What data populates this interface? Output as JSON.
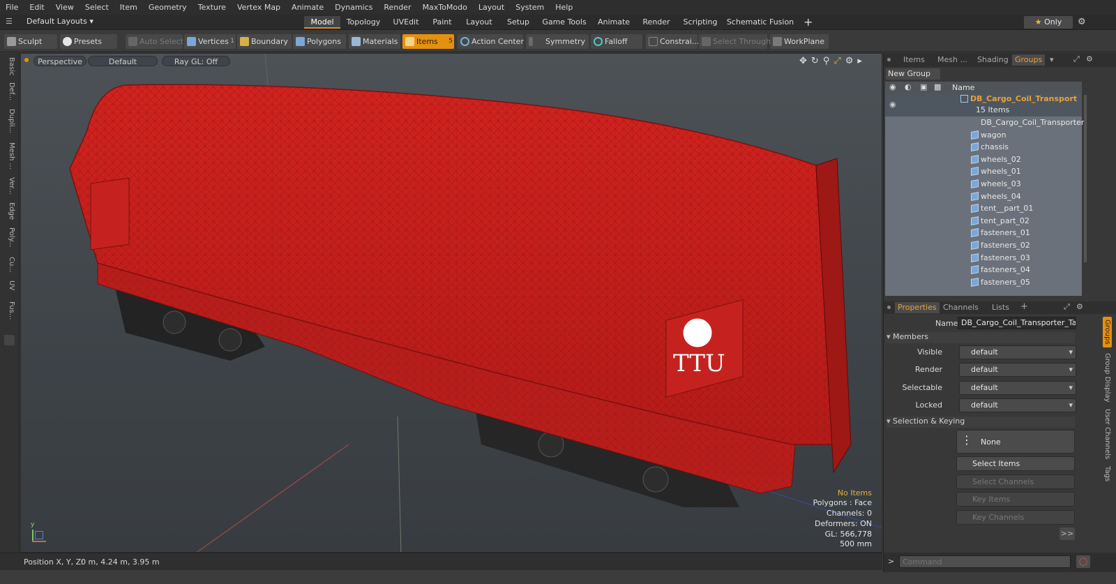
{
  "menubar": {
    "items": [
      "File",
      "Edit",
      "View",
      "Select",
      "Item",
      "Geometry",
      "Texture",
      "Vertex Map",
      "Animate",
      "Dynamics",
      "Render",
      "MaxToModo",
      "Layout",
      "System",
      "Help"
    ]
  },
  "layout_tabs": {
    "layouts_dropdown": "Default Layouts",
    "tabs": [
      "Model",
      "Topology",
      "UVEdit",
      "Paint",
      "Layout",
      "Setup",
      "Game Tools",
      "Animate",
      "Render",
      "Scripting",
      "Schematic Fusion"
    ],
    "active": "Model",
    "add": "+",
    "only_label": "Only"
  },
  "toolbar": {
    "sculpt": "Sculpt",
    "presets": "Presets",
    "auto_select": "Auto Select",
    "vertices": "Vertices",
    "vertices_count": "1",
    "boundary": "Boundary",
    "polygons": "Polygons",
    "materials": "Materials",
    "items": "Items",
    "items_count": "5",
    "action_center": "Action Center",
    "symmetry": "Symmetry",
    "falloff": "Falloff",
    "constraints": "Constrai...",
    "select_through": "Select Through",
    "workplane": "WorkPlane"
  },
  "left_tabs": [
    "Basic",
    "Def...",
    "Dupli...",
    "Mesh ...",
    "Ver...",
    "Edge",
    "Poly...",
    "Cu...",
    "UV",
    "Fus..."
  ],
  "viewport": {
    "view_mode": "Perspective",
    "shading": "Default",
    "raygl": "Ray GL: Off",
    "stats": {
      "selection": "No Items",
      "polygons": "Polygons : Face",
      "channels": "Channels: 0",
      "deformers": "Deformers: ON",
      "gl": "GL: 566,778",
      "scale": "500 mm"
    },
    "decal_text": "TTU"
  },
  "statusbar": {
    "position_label": "Position X, Y, Z:",
    "position_value": "0 m, 4.24 m, 3.95 m"
  },
  "groups_panel": {
    "tabs": [
      "Items",
      "Mesh ...",
      "Shading",
      "Groups"
    ],
    "active_tab": "Groups",
    "new_group": "New Group",
    "name_header": "Name",
    "root": {
      "name": "DB_Cargo_Coil_Transport ...",
      "count": "15 Items"
    },
    "items": [
      "DB_Cargo_Coil_Transporter ...",
      "wagon",
      "chassis",
      "wheels_02",
      "wheels_01",
      "wheels_03",
      "wheels_04",
      "tent__part_01",
      "tent_part_02",
      "fasteners_01",
      "fasteners_02",
      "fasteners_03",
      "fasteners_04",
      "fasteners_05"
    ]
  },
  "properties_panel": {
    "tabs": [
      "Properties",
      "Channels",
      "Lists"
    ],
    "active_tab": "Properties",
    "add": "+",
    "name_label": "Name",
    "name_value": "DB_Cargo_Coil_Transporter_Tarp",
    "members_section": "Members",
    "rows": [
      {
        "label": "Visible",
        "value": "default"
      },
      {
        "label": "Render",
        "value": "default"
      },
      {
        "label": "Selectable",
        "value": "default"
      },
      {
        "label": "Locked",
        "value": "default"
      }
    ],
    "selection_section": "Selection & Keying",
    "none_label": "None",
    "buttons": [
      "Select Items",
      "Select Channels",
      "Key Items",
      "Key Channels"
    ],
    "more": ">>",
    "side_tabs": [
      "Groups",
      "Group Display",
      "User Channels",
      "Tags"
    ]
  },
  "command": {
    "placeholder": "Command",
    "prompt": ">"
  },
  "colors": {
    "accent": "#e6900f",
    "group_root": "#e6a23a",
    "wagon_red": "#c31f1c"
  }
}
